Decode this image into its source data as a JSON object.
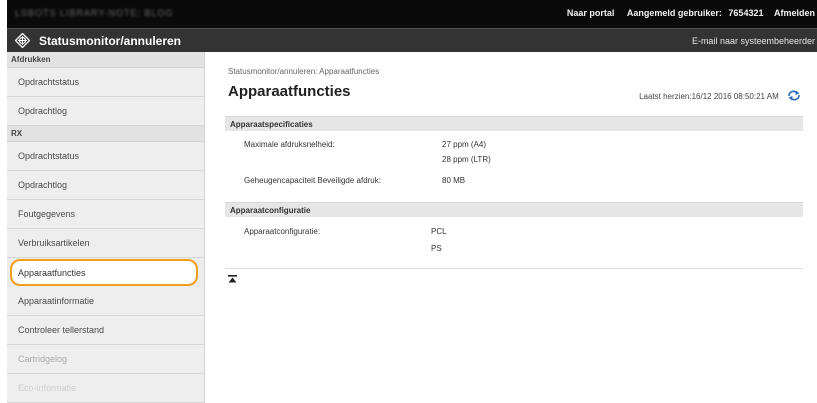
{
  "topbar": {
    "blurred_text": "LSBOTS   LIBRARY-NOTE: BLOG",
    "portal_link": "Naar portal",
    "user_label": "Aangemeld gebruiker:",
    "user_id": "7654321",
    "logout": "Afmelden"
  },
  "titlebar": {
    "title": "Statusmonitor/annuleren",
    "email_link": "E-mail naar systeembeheerder"
  },
  "sidebar": {
    "group_print": "Afdrukken",
    "print_items": [
      "Opdrachtstatus",
      "Opdrachtlog"
    ],
    "group_rx": "RX",
    "rx_items": [
      "Opdrachtstatus",
      "Opdrachtlog"
    ],
    "other_items": [
      "Foutgegevens",
      "Verbruiksartikelen",
      "Apparaatfuncties",
      "Apparaatinformatie",
      "Controleer tellerstand",
      "Cartridgelog",
      "Eco-informatie"
    ]
  },
  "main": {
    "breadcrumb": "Statusmonitor/annuleren: Apparaatfuncties",
    "title": "Apparaatfuncties",
    "last_updated": "Laatst herzien:16/12 2016 08:50:21 AM",
    "section_specs": "Apparaatspecificaties",
    "max_speed_label": "Maximale afdruksnelheid:",
    "max_speed_value1": "27 ppm (A4)",
    "max_speed_value2": "28 ppm (LTR)",
    "memory_label": "Geheugencapaciteit Beveiligde afdruk:",
    "memory_value": "80 MB",
    "section_config": "Apparaatconfiguratie",
    "config_label": "Apparaatconfiguratie:",
    "config_value1": "PCL",
    "config_value2": "PS"
  },
  "colors": {
    "highlight": "#f0a01c",
    "titlebar": "#333333",
    "topbar": "#0a0a0a"
  }
}
